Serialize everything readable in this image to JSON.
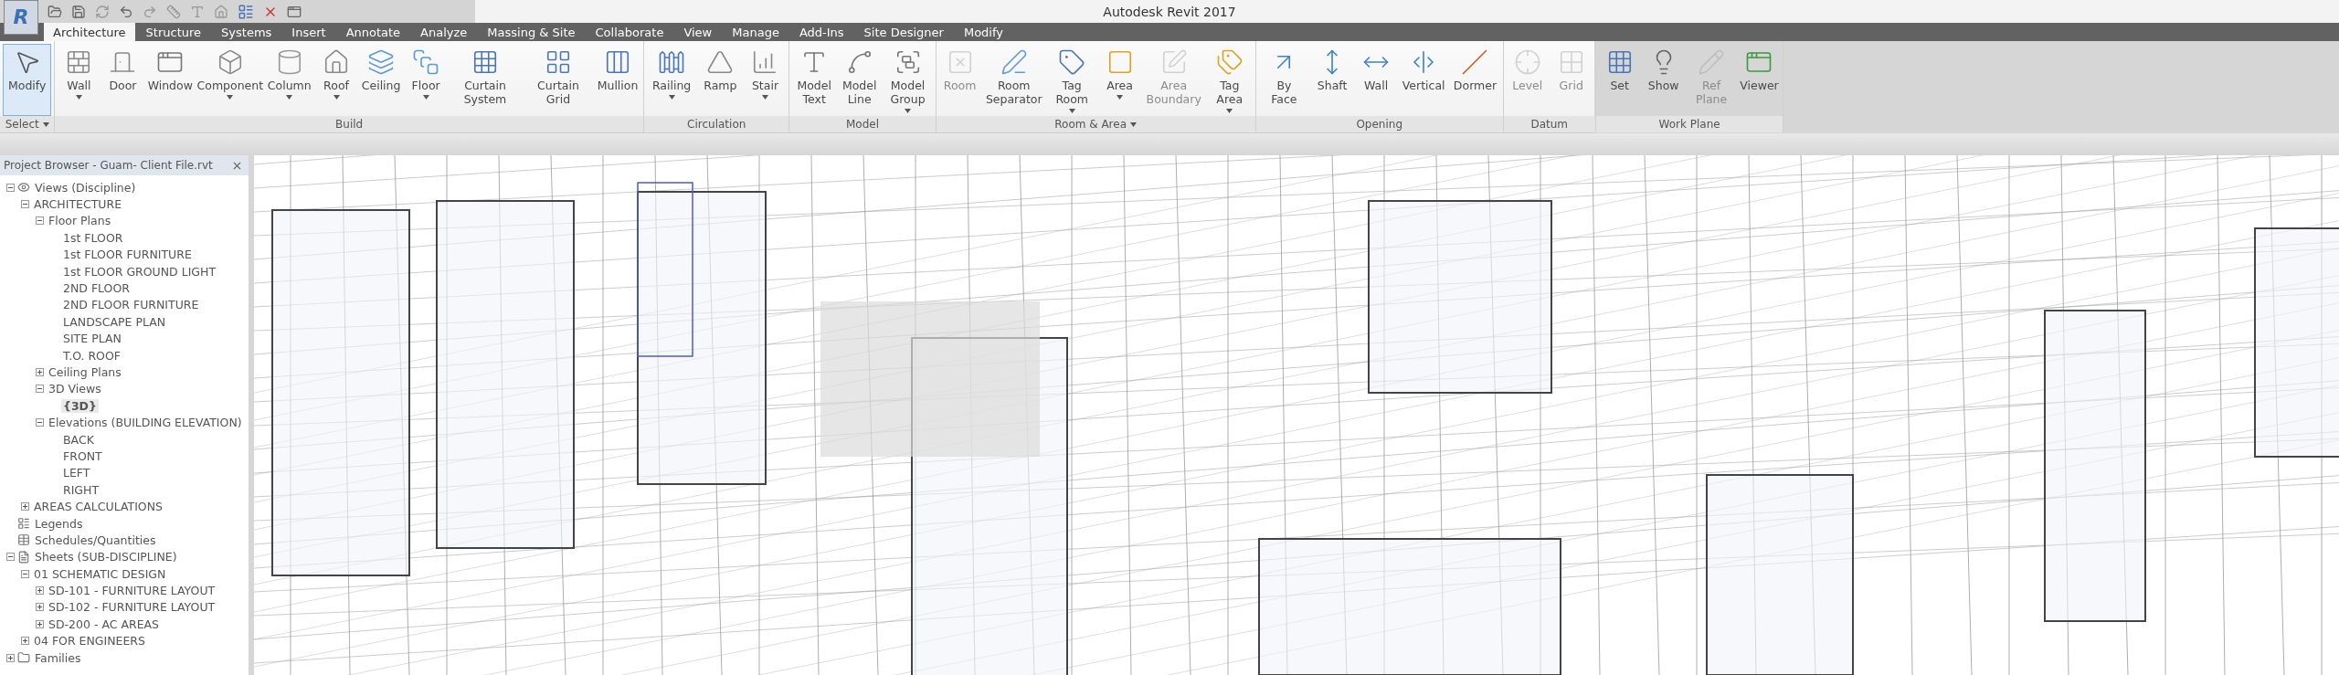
{
  "window": {
    "title": "Autodesk Revit 2017"
  },
  "application_button": {
    "label": "R"
  },
  "ribbon_tabs": [
    {
      "label": "Architecture",
      "selected": true
    },
    {
      "label": "Structure",
      "selected": false
    },
    {
      "label": "Systems",
      "selected": false
    },
    {
      "label": "Insert",
      "selected": false
    },
    {
      "label": "Annotate",
      "selected": false
    },
    {
      "label": "Analyze",
      "selected": false
    },
    {
      "label": "Massing & Site",
      "selected": false
    },
    {
      "label": "Collaborate",
      "selected": false
    },
    {
      "label": "View",
      "selected": false
    },
    {
      "label": "Manage",
      "selected": false
    },
    {
      "label": "Add-Ins",
      "selected": false
    },
    {
      "label": "Site Designer",
      "selected": false
    },
    {
      "label": "Modify",
      "selected": false
    }
  ],
  "ribbon_panels": [
    {
      "label": "Select",
      "dropdown": true,
      "tools": [
        {
          "label": "Modify",
          "selected": true,
          "dropdown": false,
          "disabled": false
        }
      ]
    },
    {
      "label": "Build",
      "dropdown": false,
      "tools": [
        {
          "label": "Wall",
          "selected": false,
          "dropdown": true,
          "disabled": false
        },
        {
          "label": "Door",
          "selected": false,
          "dropdown": false,
          "disabled": false
        },
        {
          "label": "Window",
          "selected": false,
          "dropdown": false,
          "disabled": false
        },
        {
          "label": "Component",
          "selected": false,
          "dropdown": true,
          "disabled": false
        },
        {
          "label": "Column",
          "selected": false,
          "dropdown": true,
          "disabled": false
        },
        {
          "label": "Roof",
          "selected": false,
          "dropdown": true,
          "disabled": false
        },
        {
          "label": "Ceiling",
          "selected": false,
          "dropdown": false,
          "disabled": false
        },
        {
          "label": "Floor",
          "selected": false,
          "dropdown": true,
          "disabled": false
        },
        {
          "label": "Curtain System",
          "selected": false,
          "dropdown": false,
          "disabled": false
        },
        {
          "label": "Curtain Grid",
          "selected": false,
          "dropdown": false,
          "disabled": false
        },
        {
          "label": "Mullion",
          "selected": false,
          "dropdown": false,
          "disabled": false
        }
      ]
    },
    {
      "label": "Circulation",
      "dropdown": false,
      "tools": [
        {
          "label": "Railing",
          "selected": false,
          "dropdown": true,
          "disabled": false
        },
        {
          "label": "Ramp",
          "selected": false,
          "dropdown": false,
          "disabled": false
        },
        {
          "label": "Stair",
          "selected": false,
          "dropdown": true,
          "disabled": false
        }
      ]
    },
    {
      "label": "Model",
      "dropdown": false,
      "tools": [
        {
          "label": "Model Text",
          "selected": false,
          "dropdown": false,
          "disabled": false
        },
        {
          "label": "Model Line",
          "selected": false,
          "dropdown": false,
          "disabled": false
        },
        {
          "label": "Model Group",
          "selected": false,
          "dropdown": true,
          "disabled": false
        }
      ]
    },
    {
      "label": "Room & Area",
      "dropdown": true,
      "tools": [
        {
          "label": "Room",
          "selected": false,
          "dropdown": false,
          "disabled": true
        },
        {
          "label": "Room Separator",
          "selected": false,
          "dropdown": false,
          "disabled": false
        },
        {
          "label": "Tag Room",
          "selected": false,
          "dropdown": true,
          "disabled": false
        },
        {
          "label": "Area",
          "selected": false,
          "dropdown": true,
          "disabled": false
        },
        {
          "label": "Area Boundary",
          "selected": false,
          "dropdown": false,
          "disabled": true
        },
        {
          "label": "Tag Area",
          "selected": false,
          "dropdown": true,
          "disabled": false
        }
      ]
    },
    {
      "label": "Opening",
      "dropdown": false,
      "tools": [
        {
          "label": "By Face",
          "selected": false,
          "dropdown": false,
          "disabled": false
        },
        {
          "label": "Shaft",
          "selected": false,
          "dropdown": false,
          "disabled": false
        },
        {
          "label": "Wall",
          "selected": false,
          "dropdown": false,
          "disabled": false
        },
        {
          "label": "Vertical",
          "selected": false,
          "dropdown": false,
          "disabled": false
        },
        {
          "label": "Dormer",
          "selected": false,
          "dropdown": false,
          "disabled": false
        }
      ]
    },
    {
      "label": "Datum",
      "dropdown": false,
      "tools": [
        {
          "label": "Level",
          "selected": false,
          "dropdown": false,
          "disabled": true
        },
        {
          "label": "Grid",
          "selected": false,
          "dropdown": false,
          "disabled": true
        }
      ]
    },
    {
      "label": "Work Plane",
      "dropdown": false,
      "tools": [
        {
          "label": "Set",
          "selected": false,
          "dropdown": false,
          "disabled": false
        },
        {
          "label": "Show",
          "selected": false,
          "dropdown": false,
          "disabled": false
        },
        {
          "label": "Ref Plane",
          "selected": false,
          "dropdown": false,
          "disabled": true
        },
        {
          "label": "Viewer",
          "selected": false,
          "dropdown": false,
          "disabled": false
        }
      ]
    }
  ],
  "project_browser": {
    "title": "Project Browser - Guam- Client File.rvt",
    "tree": [
      {
        "label": "Views (Discipline)",
        "kind": "views",
        "expanded": true,
        "selected": false,
        "children": [
          {
            "label": "ARCHITECTURE",
            "expanded": true,
            "selected": false,
            "children": [
              {
                "label": "Floor Plans",
                "expanded": true,
                "selected": false,
                "children": [
                  {
                    "label": "1st FLOOR",
                    "selected": false
                  },
                  {
                    "label": "1st FLOOR FURNITURE",
                    "selected": false
                  },
                  {
                    "label": "1st FLOOR GROUND LIGHT",
                    "selected": false
                  },
                  {
                    "label": "2ND FLOOR",
                    "selected": false
                  },
                  {
                    "label": "2ND FLOOR FURNITURE",
                    "selected": false
                  },
                  {
                    "label": "LANDSCAPE PLAN",
                    "selected": false
                  },
                  {
                    "label": "SITE PLAN",
                    "selected": false
                  },
                  {
                    "label": "T.O. ROOF",
                    "selected": false
                  }
                ]
              },
              {
                "label": "Ceiling Plans",
                "expanded": false,
                "selected": false
              },
              {
                "label": "3D Views",
                "expanded": true,
                "selected": false,
                "children": [
                  {
                    "label": "{3D}",
                    "selected": true
                  }
                ]
              },
              {
                "label": "Elevations (BUILDING ELEVATION)",
                "expanded": true,
                "selected": false,
                "children": [
                  {
                    "label": "BACK",
                    "selected": false
                  },
                  {
                    "label": "FRONT",
                    "selected": false
                  },
                  {
                    "label": "LEFT",
                    "selected": false
                  },
                  {
                    "label": "RIGHT",
                    "selected": false
                  }
                ]
              }
            ]
          },
          {
            "label": "AREAS CALCULATIONS",
            "expanded": false,
            "selected": false
          }
        ]
      },
      {
        "label": "Legends",
        "kind": "legends",
        "selected": false
      },
      {
        "label": "Schedules/Quantities",
        "kind": "schedules",
        "selected": false
      },
      {
        "label": "Sheets (SUB-DISCIPLINE)",
        "kind": "sheets",
        "expanded": true,
        "selected": false,
        "children": [
          {
            "label": "01 SCHEMATIC DESIGN",
            "expanded": true,
            "selected": false,
            "children": [
              {
                "label": "SD-101 - FURNITURE LAYOUT",
                "expanded": false,
                "selected": false
              },
              {
                "label": "SD-102 - FURNITURE LAYOUT",
                "expanded": false,
                "selected": false
              },
              {
                "label": "SD-200 - AC AREAS",
                "expanded": false,
                "selected": false
              }
            ]
          },
          {
            "label": "04 FOR ENGINEERS",
            "expanded": false,
            "selected": false
          }
        ]
      },
      {
        "label": "Families",
        "kind": "families",
        "expanded": false,
        "selected": false
      }
    ]
  }
}
